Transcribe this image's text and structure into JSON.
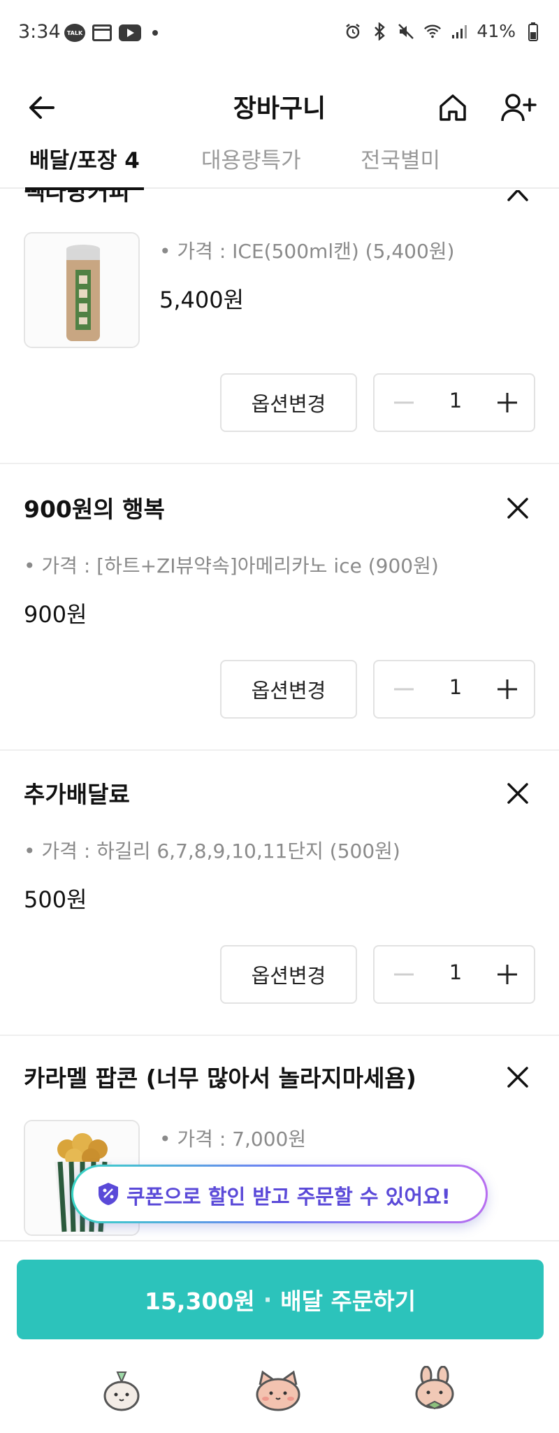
{
  "status_bar": {
    "time": "3:34",
    "talk_label": "TALK",
    "battery": "41%"
  },
  "header": {
    "title": "장바구니"
  },
  "tabs": [
    {
      "label": "배달/포장 4"
    },
    {
      "label": "대용량특가"
    },
    {
      "label": "전국별미"
    }
  ],
  "cart": {
    "items": [
      {
        "name": "빽다방커피",
        "option": "• 가격 : ICE(500ml캔) (5,400원)",
        "price": "5,400원",
        "option_change_label": "옵션변경",
        "quantity": "1"
      },
      {
        "name": "900원의 행복",
        "option": "• 가격 : [하트+ZI뷰약속]아메리카노 ice (900원)",
        "price": "900원",
        "option_change_label": "옵션변경",
        "quantity": "1"
      },
      {
        "name": "추가배달료",
        "option": "• 가격 : 하길리 6,7,8,9,10,11단지 (500원)",
        "price": "500원",
        "option_change_label": "옵션변경",
        "quantity": "1"
      },
      {
        "name": "카라멜 팝콘 (너무 많아서 놀라지마세욤)",
        "option": "• 가격 : 7,000원"
      }
    ]
  },
  "coupon_banner": {
    "text": "쿠폰으로 할인 받고 주문할 수 있어요!"
  },
  "order_button": {
    "amount": "15,300원",
    "separator": "·",
    "label": "배달 주문하기"
  },
  "colors": {
    "accent": "#2cc3bb",
    "coupon_text": "#5a49d8"
  }
}
